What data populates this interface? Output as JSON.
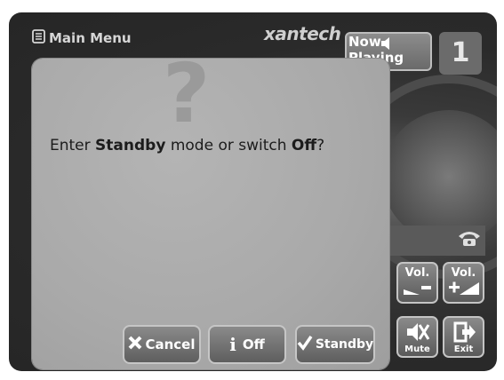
{
  "header": {
    "main_menu_label": "Main Menu",
    "brand": "xantech",
    "now_playing_label": "Now Playing",
    "zone_number": "1"
  },
  "controls": {
    "vol_down_label": "Vol.",
    "vol_up_label": "Vol.",
    "mute_label": "Mute",
    "exit_label": "Exit"
  },
  "dialog": {
    "message_prefix": "Enter ",
    "message_bold1": "Standby",
    "message_middle": " mode or switch ",
    "message_bold2": "Off",
    "message_suffix": "?",
    "cancel_label": "Cancel",
    "off_label": "Off",
    "standby_label": "Standby"
  },
  "icons": {
    "main_menu": "document-icon",
    "now_playing": "speaker-icon",
    "phone": "phone-icon",
    "cancel": "x-icon",
    "off": "info-icon",
    "standby": "checkmark-icon",
    "dialog": "question-mark-icon"
  }
}
